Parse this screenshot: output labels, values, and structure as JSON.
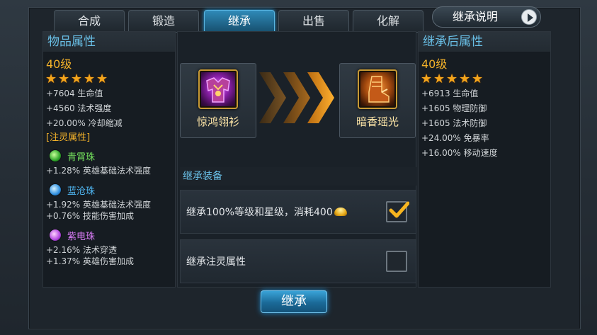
{
  "tabs": [
    {
      "label": "合成",
      "active": false
    },
    {
      "label": "锻造",
      "active": false
    },
    {
      "label": "继承",
      "active": true
    },
    {
      "label": "出售",
      "active": false
    },
    {
      "label": "化解",
      "active": false
    }
  ],
  "help_button": {
    "label": "继承说明"
  },
  "left_panel": {
    "title": "物品属性",
    "level": "40级",
    "stars": 5,
    "stats": [
      "+7604 生命值",
      "+4560 法术强度",
      "+20.00% 冷却缩减"
    ],
    "spirit_title": "[注灵属性]",
    "gems": [
      {
        "name": "青霄珠",
        "color": "green",
        "stats": [
          "+1.28% 英雄基础法术强度"
        ]
      },
      {
        "name": "蓝沧珠",
        "color": "blue",
        "stats": [
          "+1.92% 英雄基础法术强度",
          "+0.76% 技能伤害加成"
        ]
      },
      {
        "name": "紫电珠",
        "color": "purple",
        "stats": [
          "+2.16% 法术穿透",
          "+1.37% 英雄伤害加成"
        ]
      }
    ]
  },
  "source_item": {
    "name": "惊鸿翎衫",
    "icon": "armor-icon"
  },
  "target_item": {
    "name": "暗香瑶光",
    "icon": "boots-icon"
  },
  "inherit_section": {
    "label": "继承装备",
    "options": [
      {
        "text": "继承100%等级和星级，消耗400",
        "checked": true,
        "currency_icon": "gold-ingot-icon"
      },
      {
        "text": "继承注灵属性",
        "checked": false
      }
    ]
  },
  "right_panel": {
    "title": "继承后属性",
    "level": "40级",
    "stars": 5,
    "stats": [
      "+6913 生命值",
      "+1605 物理防御",
      "+1605 法术防御",
      "+24.00% 免暴率",
      "+16.00% 移动速度"
    ]
  },
  "inherit_button": {
    "label": "继承"
  },
  "colors": {
    "accent": "#69bfe6",
    "gold": "#f2b12a",
    "active_tab": "#2f8ab8"
  }
}
